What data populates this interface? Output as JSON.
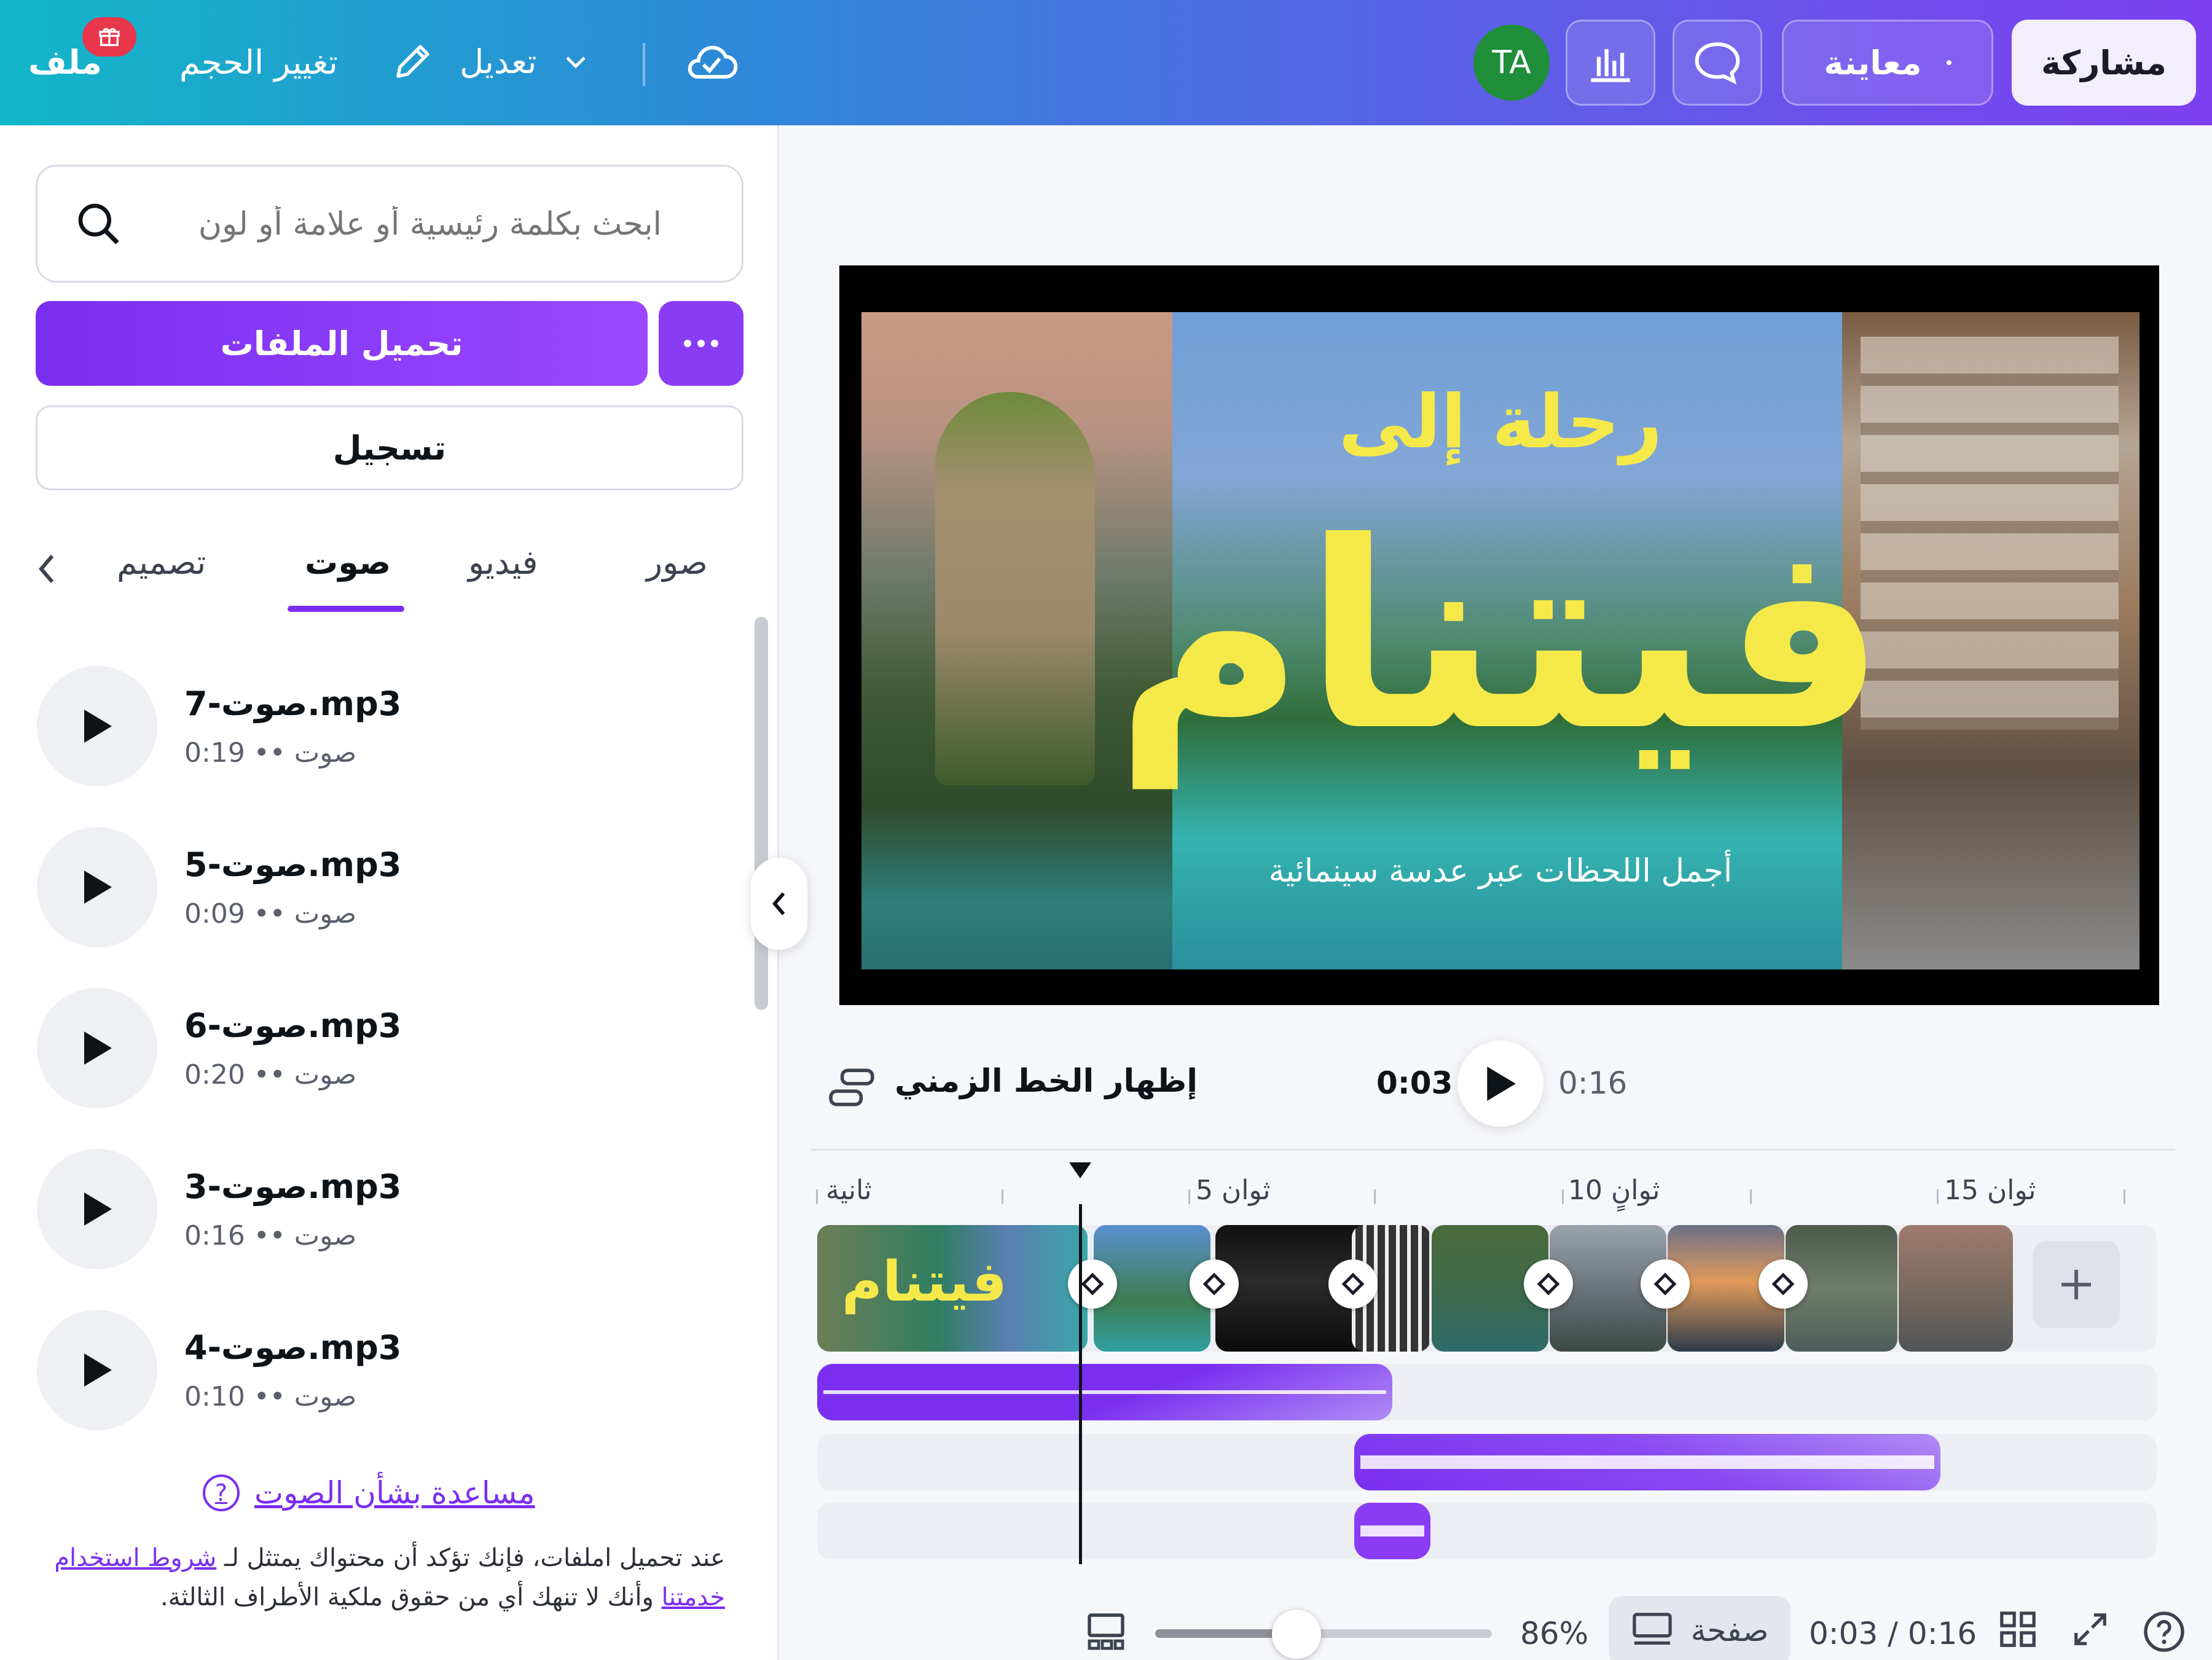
{
  "topbar": {
    "file_label": "ملف",
    "resize_label": "تغيير الحجم",
    "edit_label": "تعديل",
    "avatar_initials": "TA",
    "preview_label": "معاينة",
    "share_label": "مشاركة"
  },
  "sidebar": {
    "search_placeholder": "ابحث بكلمة رئيسية أو علامة أو لون",
    "upload_label": "تحميل الملفات",
    "record_label": "تسجيل",
    "tabs": [
      {
        "label": "صور",
        "active": false
      },
      {
        "label": "فيديو",
        "active": false
      },
      {
        "label": "صوت",
        "active": true
      },
      {
        "label": "تصميم",
        "active": false
      }
    ],
    "audio_items": [
      {
        "name": "صوت-7.mp3",
        "meta": "0:19 •• صوت"
      },
      {
        "name": "صوت-5.mp3",
        "meta": "0:09 •• صوت"
      },
      {
        "name": "صوت-6.mp3",
        "meta": "0:20 •• صوت"
      },
      {
        "name": "صوت-3.mp3",
        "meta": "0:16 •• صوت"
      },
      {
        "name": "صوت-4.mp3",
        "meta": "0:10 •• صوت"
      }
    ],
    "help_link": "مساعدة بشأن الصوت",
    "terms_prefix": "عند تحميل املفات، فإنك تؤكد أن محتواك يمتثل لـ ",
    "terms_link1": "شروط استخدام",
    "terms_link2": "خدمتنا",
    "terms_suffix": " وأنك لا تنهك أي من حقوق ملكية الأطراف الثالثة."
  },
  "canvas": {
    "title_small": "رحلة إلى",
    "title_big": "فيتنام",
    "subtitle": "أجمل اللحظات عبر عدسة سينمائية"
  },
  "playback": {
    "timeline_toggle": "إظهار الخط الزمني",
    "current_time": "0:03",
    "total_time": "0:16"
  },
  "timeline": {
    "ruler_labels": [
      "ثانية",
      "5 ثوان",
      "10 ثوانٍ",
      "15 ثوان"
    ]
  },
  "bottombar": {
    "zoom_percent": "86%",
    "zoom_level": 0.42,
    "page_label": "صفحة",
    "time_readout": "0:03 / 0:16"
  },
  "colors": {
    "accent": "#7a2ff0",
    "title_yellow": "#f5e94a",
    "avatar_green": "#1f8f3a",
    "badge_red": "#e8364b"
  }
}
